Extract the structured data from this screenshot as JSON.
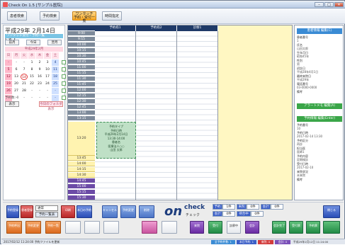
{
  "window": {
    "title": "Check On 1.5 [サンプル医院]"
  },
  "toolbar": {
    "buttons": [
      "患者検索",
      "予約検索",
      "予約一覧表",
      "時間指定"
    ],
    "active_sub": "ワンタッチ",
    "active_label": "予約・受付一覧"
  },
  "left": {
    "date_title": "平成29年 2月14日(火)",
    "date_sub": "ワンタッチ受付・予約一覧",
    "nav_prev": "前月",
    "nav_today": "今日",
    "nav_next": "翌月",
    "month_label": "平成29年2月",
    "weekdays": [
      "日",
      "月",
      "火",
      "水",
      "木",
      "金",
      "土"
    ],
    "weeks": [
      [
        "-",
        "-",
        "-",
        "1",
        "2",
        "3",
        "4"
      ],
      [
        "5",
        "6",
        "7",
        "8",
        "9",
        "10",
        "11"
      ],
      [
        "12",
        "13",
        "14",
        "15",
        "16",
        "17",
        "18"
      ],
      [
        "19",
        "20",
        "21",
        "22",
        "23",
        "24",
        "25"
      ],
      [
        "26",
        "27",
        "28",
        "-",
        "-",
        "-",
        "-"
      ],
      [
        "-",
        "-",
        "-",
        "-",
        "-",
        "-",
        "-"
      ]
    ],
    "note": "予約数: 0",
    "btn_a": "表示",
    "btn_b": "今日のフォルダ表示"
  },
  "schedule": {
    "columns": [
      "予約枠1",
      "予約枠2",
      "診察1"
    ],
    "times": [
      "9:00",
      "9:15",
      "10:00",
      "10:15",
      "10:30",
      "10:45",
      "11:00",
      "11:15",
      "11:30",
      "11:45",
      "12:00",
      "12:15",
      "12:30",
      "12:45",
      "13:00",
      "13:15",
      "13:20",
      "",
      "",
      "",
      "",
      "",
      "13:45",
      "14:00",
      "14:15",
      "14:30",
      "14:45",
      "15:00",
      "15:15",
      "15:30"
    ],
    "appointment": [
      "予約タイプ",
      "予約日時",
      "平成29年2月14日",
      "13:30-14:00",
      "患者名",
      "医療法人○○",
      "山田 太郎"
    ]
  },
  "right": {
    "header1": "患者情報 編集(C)",
    "fields": [
      [
        "患者番号",
        "1"
      ],
      [
        "氏名",
        "山田太郎"
      ],
      [
        "生年月日",
        "昭和45年"
      ],
      [
        "性別",
        "男"
      ],
      [
        "初診日",
        "平成28年4月1日"
      ],
      [
        "最終来院日",
        "平成29年"
      ],
      [
        "電話番号",
        "03-0000-0000"
      ],
      [
        "備考",
        ""
      ]
    ],
    "header2": "アラートメモ 編集(A)",
    "header3": "予約情報 編集(Enter)",
    "fields2": [
      [
        "予約番号",
        "10"
      ],
      [
        "予約日時",
        "2017-02-14 13:30"
      ],
      [
        "予約区分",
        "再診"
      ],
      [
        "担当医",
        "医師1"
      ],
      [
        "予約内容",
        "定期検診"
      ],
      [
        "受付日時",
        "2017-02-10"
      ],
      [
        "来院状況",
        "未来院"
      ],
      [
        "備考",
        ""
      ]
    ]
  },
  "bottom": {
    "row1": [
      "予約登録",
      "患者登録",
      "通常",
      "予約一覧表",
      "印刷",
      "本日の予約",
      "キャンセル",
      "予約変更",
      "削除"
    ],
    "row2": [
      "予約呼出",
      "予約変更",
      "予約一覧",
      "",
      "",
      "",
      "",
      "",
      "来院",
      "受付",
      "診察中",
      "会計",
      "会計完了",
      "閉じる",
      "受付票",
      "予約票"
    ],
    "logo_on": "on",
    "logo_check": "check",
    "logo_jp": "チェック",
    "counters": [
      "予約",
      "1件",
      "来院",
      "0件",
      "会計",
      "0件",
      "会計",
      "0件",
      "待合中",
      "0件"
    ],
    "dropdown": "通常"
  },
  "status": {
    "left": "2017/02/12 11:24:00 予約ファイルを更新",
    "mid": [
      "全予約件数: 1",
      "本日予約: 1",
      "来院: 0",
      "会計: 0"
    ],
    "right": "平成29年2月12日 11:24:00"
  },
  "colors": {
    "header_navy": "#1f3a68",
    "appt_green": "#bfe0c6",
    "accent_orange": "#f6a623"
  }
}
